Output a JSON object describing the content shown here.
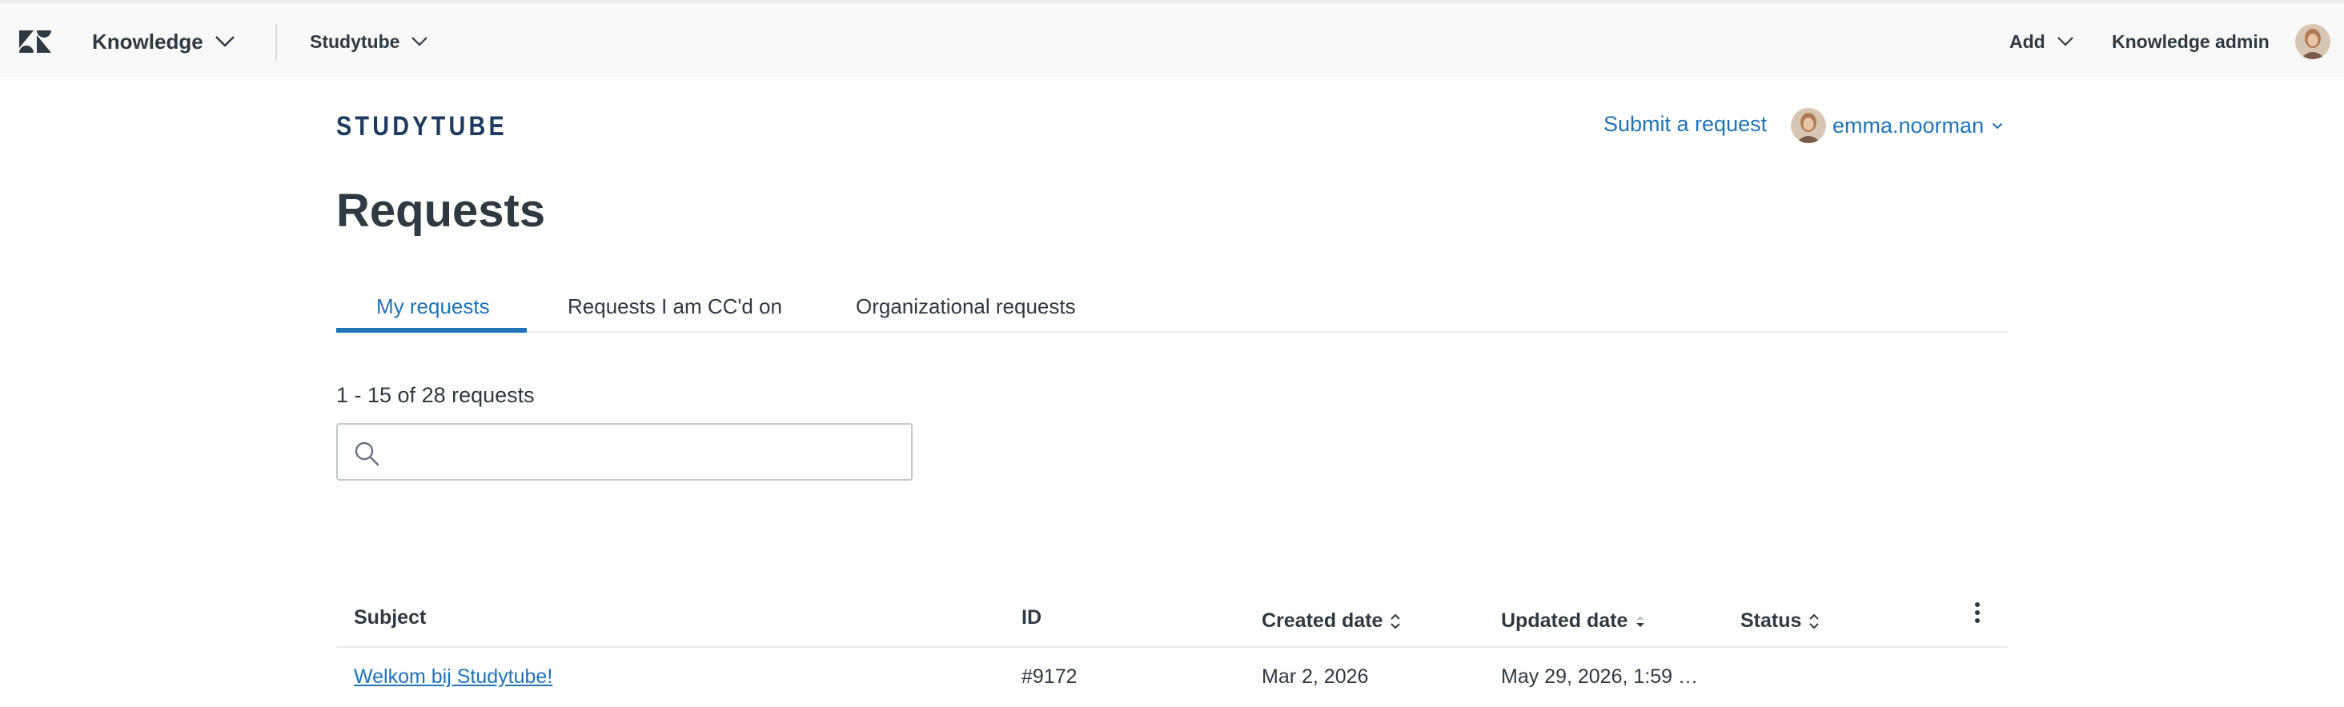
{
  "topbar": {
    "logo_icon": "zendesk-logo-icon",
    "knowledge_label": "Knowledge",
    "brand_switch_label": "Studytube",
    "add_label": "Add",
    "admin_label": "Knowledge admin"
  },
  "header": {
    "brand": "STUDYTUBE",
    "submit_request": "Submit a request",
    "username": "emma.noorman"
  },
  "page": {
    "title": "Requests",
    "tabs": [
      {
        "label": "My requests",
        "active": true
      },
      {
        "label": "Requests I am CC'd on",
        "active": false
      },
      {
        "label": "Organizational requests",
        "active": false
      }
    ],
    "count_text": "1 - 15 of 28 requests",
    "search": {
      "value": "",
      "placeholder": ""
    }
  },
  "table": {
    "columns": [
      "Subject",
      "ID",
      "Created date",
      "Updated date",
      "Status"
    ],
    "rows": [
      {
        "subject": "Welkom bij Studytube!",
        "id": "#9172",
        "created": "Mar 2, 2026",
        "updated": "May 29, 2026, 1:59 …",
        "status": ""
      }
    ]
  },
  "colors": {
    "accent": "#1f73b7",
    "text": "#2f3941",
    "brand": "#1f3a5f",
    "topbar_bg": "#f8f9f9"
  }
}
